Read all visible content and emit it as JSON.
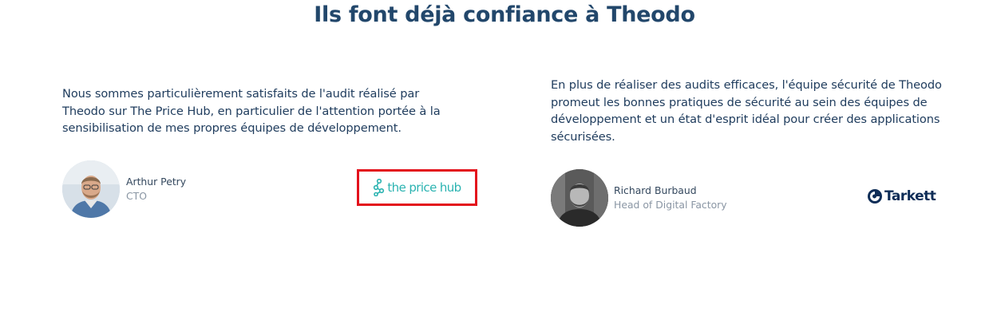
{
  "section": {
    "title": "Ils font déjà confiance à Theodo"
  },
  "testimonials": [
    {
      "quote": "Nous sommes particulièrement satisfaits de l'audit réalisé par Theodo sur The Price Hub, en particulier de l'attention portée à la sensibilisation de mes propres équipes de développement.",
      "name": "Arthur Petry",
      "role": "CTO",
      "logo_text": "the price hub",
      "logo_color": "#2bb3b1",
      "highlight_color": "#e3121c"
    },
    {
      "quote": "En plus de réaliser des audits efficaces, l'équipe sécurité de Theodo promeut les bonnes pratiques de sécurité au sein des équipes de développement et un état d'esprit idéal pour créer des applications sécurisées.",
      "name": "Richard Burbaud",
      "role": "Head of Digital Factory",
      "logo_text": "Tarkett",
      "logo_color": "#0e2d57"
    }
  ],
  "colors": {
    "title": "#22476b",
    "body_text": "#203d5e",
    "muted_text": "#8a96a4"
  }
}
